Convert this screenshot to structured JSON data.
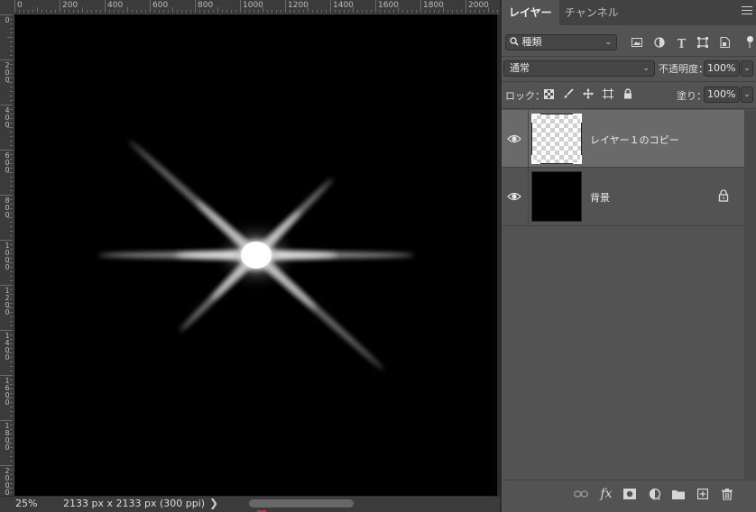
{
  "ruler": {
    "top_labels": [
      "0",
      "200",
      "400",
      "600",
      "800",
      "1000",
      "1200",
      "1400",
      "1600",
      "1800",
      "2000"
    ],
    "left_labels": [
      "0",
      "200",
      "400",
      "600",
      "800",
      "1000",
      "1200",
      "1400",
      "1600",
      "1800",
      "2000"
    ]
  },
  "status": {
    "zoom": "25%",
    "doc_size": "2133 px x 2133 px (300 ppi)",
    "arrow": "❯"
  },
  "panel": {
    "tabs": [
      {
        "label": "レイヤー",
        "active": true
      },
      {
        "label": "チャンネル",
        "active": false
      }
    ],
    "filter": {
      "kind_label": "種類",
      "icons": [
        "image-filter-icon",
        "adjustment-filter-icon",
        "type-filter-icon",
        "shape-filter-icon",
        "smart-object-filter-icon"
      ]
    },
    "blend_mode": "通常",
    "opacity_label": "不透明度：",
    "opacity_value": "100%",
    "lock_label": "ロック：",
    "lock_icons": [
      "lock-transparent-pixels-icon",
      "lock-image-pixels-icon",
      "lock-position-icon",
      "lock-artboard-icon",
      "lock-all-icon"
    ],
    "fill_label": "塗り：",
    "fill_value": "100%",
    "layers": [
      {
        "name": "レイヤー１のコピー",
        "visible": true,
        "selected": true,
        "locked": false,
        "thumbnail": "transparent"
      },
      {
        "name": "背景",
        "visible": true,
        "selected": false,
        "locked": true,
        "thumbnail": "black"
      }
    ],
    "bottom_icons": [
      "link-layers-icon",
      "fx-icon",
      "add-mask-icon",
      "adjustment-layer-icon",
      "new-group-icon",
      "new-layer-icon",
      "delete-layer-icon"
    ],
    "fx_label": "fx"
  },
  "colors": {
    "panel_bg": "#535353",
    "selected_layer_bg": "#6a6a6a",
    "canvas_bg": "#000000"
  }
}
